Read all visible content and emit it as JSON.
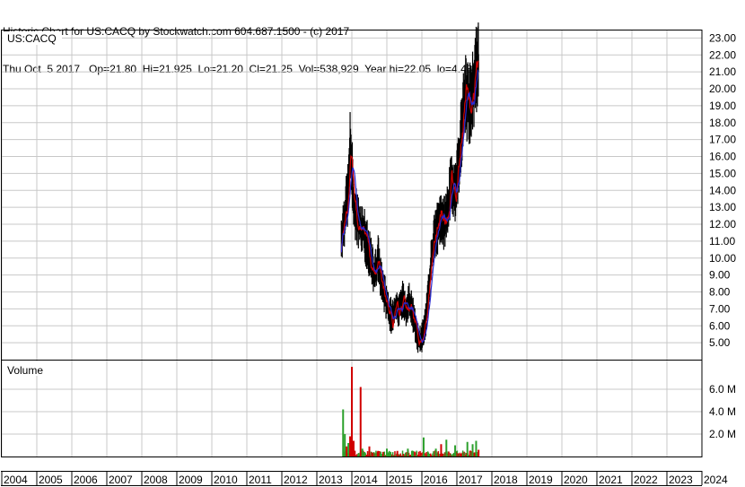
{
  "header": {
    "line1": "Historic Chart for US:CACQ by Stockwatch.com 604.687.1500 - (c) 2017",
    "line2": "Thu Oct  5 2017   Op=21.80  Hi=21.925  Lo=21.20  Cl=21.25  Vol=538,929  Year hi=22.05  lo=4.48"
  },
  "colors": {
    "background": "#ffffff",
    "grid": "#c8c8c8",
    "border": "#000000",
    "price_bar": "#000000",
    "ma_short": "#d00000",
    "ma_long": "#2a2ad0",
    "volume_up": "#2ca02c",
    "volume_down": "#d00000"
  },
  "chart_data": [
    {
      "type": "line",
      "label": "US:CACQ",
      "y_ticks": [
        "23.00",
        "22.00",
        "21.00",
        "20.00",
        "19.00",
        "18.00",
        "17.00",
        "16.00",
        "15.00",
        "14.00",
        "13.00",
        "12.00",
        "11.00",
        "10.00",
        "9.00",
        "8.00",
        "7.00",
        "6.00",
        "5.00"
      ],
      "ylim": [
        4.0,
        23.5
      ],
      "x_ticks": [
        "2004",
        "2005",
        "2006",
        "2007",
        "2008",
        "2009",
        "2010",
        "2011",
        "2012",
        "2013",
        "2014",
        "2015",
        "2016",
        "2017",
        "2018",
        "2019",
        "2020",
        "2021",
        "2022",
        "2023",
        "2024"
      ],
      "xlim": [
        2004.0,
        2024.0
      ],
      "grid": true,
      "price_points": [
        [
          2013.7,
          11.2
        ],
        [
          2013.8,
          12.5
        ],
        [
          2013.9,
          14.0
        ],
        [
          2013.95,
          16.5
        ],
        [
          2014.0,
          15.5
        ],
        [
          2014.05,
          13.0
        ],
        [
          2014.2,
          12.0
        ],
        [
          2014.35,
          11.5
        ],
        [
          2014.45,
          10.6
        ],
        [
          2014.55,
          9.8
        ],
        [
          2014.65,
          9.0
        ],
        [
          2014.75,
          10.0
        ],
        [
          2014.85,
          8.5
        ],
        [
          2014.95,
          7.8
        ],
        [
          2015.05,
          7.0
        ],
        [
          2015.15,
          6.4
        ],
        [
          2015.25,
          7.2
        ],
        [
          2015.35,
          6.9
        ],
        [
          2015.45,
          7.5
        ],
        [
          2015.55,
          7.1
        ],
        [
          2015.65,
          7.4
        ],
        [
          2015.75,
          6.6
        ],
        [
          2015.85,
          5.5
        ],
        [
          2015.95,
          5.1
        ],
        [
          2016.05,
          5.6
        ],
        [
          2016.15,
          7.0
        ],
        [
          2016.25,
          9.5
        ],
        [
          2016.35,
          11.0
        ],
        [
          2016.45,
          11.8
        ],
        [
          2016.55,
          12.5
        ],
        [
          2016.65,
          12.0
        ],
        [
          2016.75,
          13.0
        ],
        [
          2016.85,
          14.5
        ],
        [
          2016.95,
          14.0
        ],
        [
          2017.05,
          15.5
        ],
        [
          2017.15,
          18.0
        ],
        [
          2017.25,
          19.5
        ],
        [
          2017.35,
          19.0
        ],
        [
          2017.45,
          19.8
        ],
        [
          2017.55,
          21.0
        ],
        [
          2017.62,
          21.9
        ]
      ],
      "year_hi": 22.05,
      "year_lo": 4.48
    },
    {
      "type": "bar",
      "label": "Volume",
      "y_ticks": [
        "6.0 M",
        "4.0 M",
        "2.0 M"
      ],
      "ylim": [
        0,
        8000000
      ],
      "xlim": [
        2004.0,
        2024.0
      ],
      "spikes": [
        [
          2013.75,
          4200000,
          "up"
        ],
        [
          2013.8,
          2000000,
          "up"
        ],
        [
          2013.85,
          900000,
          "down"
        ],
        [
          2013.9,
          1200000,
          "up"
        ],
        [
          2013.95,
          1800000,
          "down"
        ],
        [
          2014.0,
          8000000,
          "down"
        ],
        [
          2014.05,
          1400000,
          "down"
        ],
        [
          2014.25,
          6200000,
          "down"
        ],
        [
          2014.3,
          700000,
          "up"
        ],
        [
          2014.5,
          900000,
          "down"
        ],
        [
          2014.75,
          500000,
          "down"
        ],
        [
          2015.0,
          700000,
          "up"
        ],
        [
          2015.3,
          500000,
          "down"
        ],
        [
          2015.6,
          700000,
          "up"
        ],
        [
          2016.05,
          1700000,
          "up"
        ],
        [
          2016.4,
          700000,
          "up"
        ],
        [
          2016.55,
          1100000,
          "down"
        ],
        [
          2016.7,
          1500000,
          "up"
        ],
        [
          2016.95,
          1000000,
          "up"
        ],
        [
          2017.3,
          1300000,
          "up"
        ],
        [
          2017.45,
          1100000,
          "up"
        ],
        [
          2017.55,
          1400000,
          "up"
        ],
        [
          2017.62,
          600000,
          "down"
        ]
      ]
    }
  ]
}
